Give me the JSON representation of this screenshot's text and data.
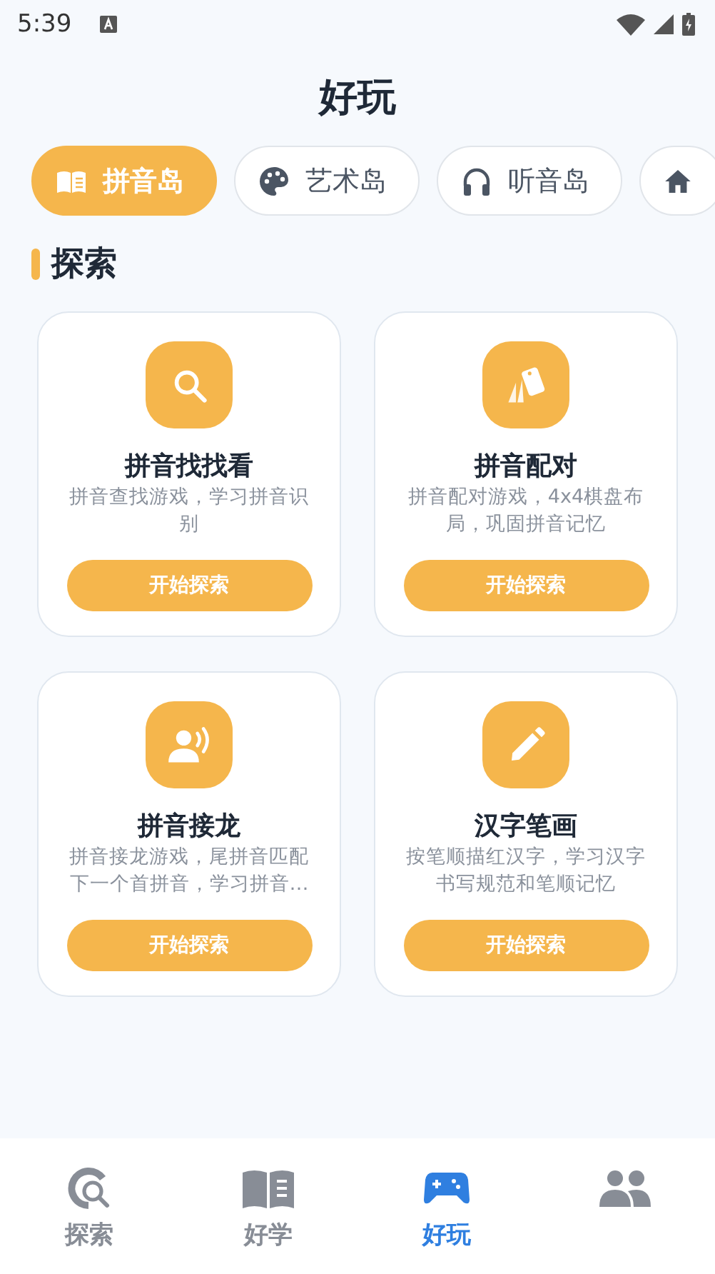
{
  "status_bar": {
    "time": "5:39"
  },
  "title": "好玩",
  "tabs": [
    {
      "label": "拼音岛",
      "selected": true
    },
    {
      "label": "艺术岛",
      "selected": false
    },
    {
      "label": "听音岛",
      "selected": false
    },
    {
      "selected": false
    }
  ],
  "section": {
    "title": "探索"
  },
  "cards": [
    {
      "title": "拼音找找看",
      "description": "拼音查找游戏，学习拼音识别",
      "button": "开始探索"
    },
    {
      "title": "拼音配对",
      "description": "拼音配对游戏，4x4棋盘布局，巩固拼音记忆",
      "button": "开始探索"
    },
    {
      "title": "拼音接龙",
      "description": "拼音接龙游戏，尾拼音匹配下一个首拼音，学习拼音…",
      "button": "开始探索"
    },
    {
      "title": "汉字笔画",
      "description": "按笔顺描红汉字，学习汉字书写规范和笔顺记忆",
      "button": "开始探索"
    }
  ],
  "bottom_nav": [
    {
      "label": "探索",
      "selected": false
    },
    {
      "label": "好学",
      "selected": false
    },
    {
      "label": "好玩",
      "selected": true
    },
    {
      "selected": false
    }
  ]
}
